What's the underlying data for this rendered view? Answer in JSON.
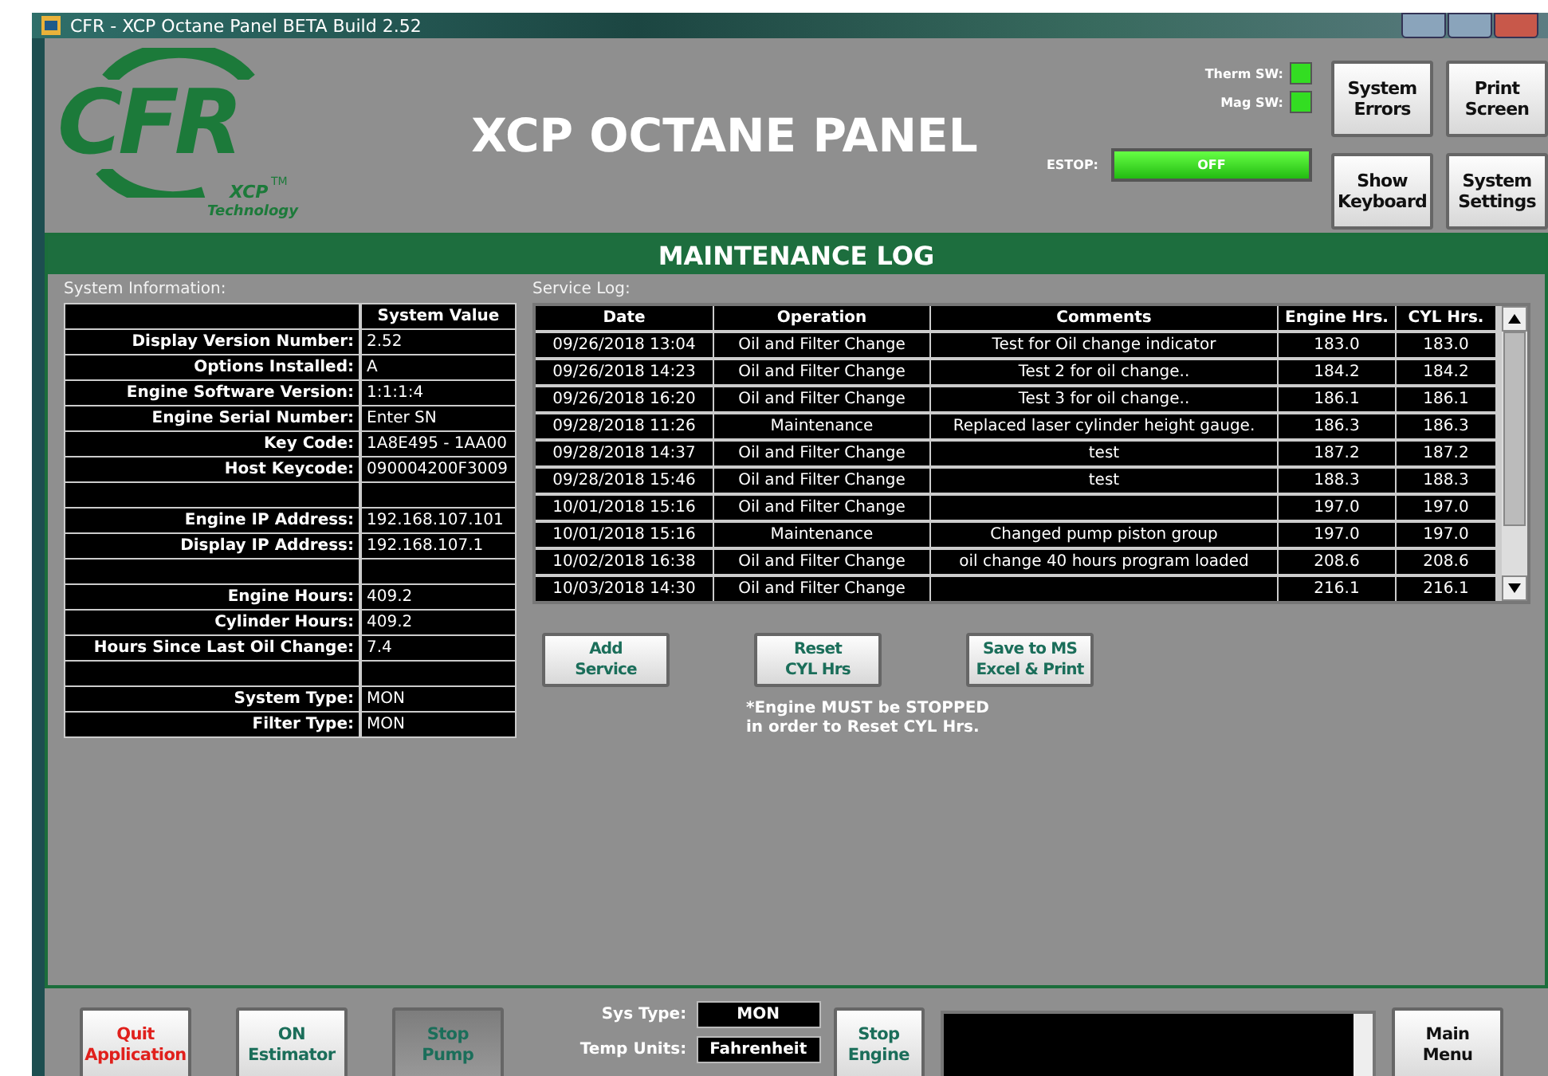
{
  "window": {
    "title": "CFR - XCP Octane Panel BETA Build 2.52"
  },
  "header": {
    "logo": {
      "text": "CFR",
      "sub": "XCP",
      "tm": "TM",
      "tagline": "Technology"
    },
    "title": "XCP OCTANE PANEL",
    "indicators": [
      {
        "label": "Therm SW:",
        "on": true
      },
      {
        "label": "Mag SW:",
        "on": true
      }
    ],
    "estop": {
      "label": "ESTOP:",
      "value": "OFF",
      "on": true
    },
    "buttons": [
      "System\nErrors",
      "Print\nScreen",
      "Show\nKeyboard",
      "System\nSettings"
    ]
  },
  "panel": {
    "title": "MAINTENANCE LOG"
  },
  "system_info": {
    "title": "System Information:",
    "value_header": "System Value",
    "rows": [
      {
        "label": "Display Version Number:",
        "value": "2.52"
      },
      {
        "label": "Options Installed:",
        "value": "A"
      },
      {
        "label": "Engine Software Version:",
        "value": "1:1:1:4"
      },
      {
        "label": "Engine Serial Number:",
        "value": "Enter SN"
      },
      {
        "label": "Key Code:",
        "value": "1A8E495 - 1AA00"
      },
      {
        "label": "Host Keycode:",
        "value": "090004200F3009"
      },
      {},
      {
        "label": "Engine IP Address:",
        "value": "192.168.107.101"
      },
      {
        "label": "Display IP Address:",
        "value": "192.168.107.1"
      },
      {},
      {
        "label": "Engine Hours:",
        "value": "409.2"
      },
      {
        "label": "Cylinder Hours:",
        "value": "409.2"
      },
      {
        "label": "Hours Since Last Oil Change:",
        "value": "7.4"
      },
      {},
      {
        "label": "System Type:",
        "value": "MON"
      },
      {
        "label": "Filter Type:",
        "value": "MON"
      }
    ]
  },
  "service_log": {
    "title": "Service Log:",
    "columns": [
      "Date",
      "Operation",
      "Comments",
      "Engine Hrs.",
      "CYL Hrs."
    ],
    "rows": [
      [
        "09/26/2018 13:04",
        "Oil and Filter Change",
        "Test for Oil change indicator",
        "183.0",
        "183.0"
      ],
      [
        "09/26/2018 14:23",
        "Oil and Filter Change",
        "Test 2 for oil change..",
        "184.2",
        "184.2"
      ],
      [
        "09/26/2018 16:20",
        "Oil and Filter Change",
        "Test 3 for oil change..",
        "186.1",
        "186.1"
      ],
      [
        "09/28/2018 11:26",
        "Maintenance",
        "Replaced laser cylinder height gauge.",
        "186.3",
        "186.3"
      ],
      [
        "09/28/2018 14:37",
        "Oil and Filter Change",
        "test",
        "187.2",
        "187.2"
      ],
      [
        "09/28/2018 15:46",
        "Oil and Filter Change",
        "test",
        "188.3",
        "188.3"
      ],
      [
        "10/01/2018 15:16",
        "Oil and Filter Change",
        null,
        "197.0",
        "197.0"
      ],
      [
        "10/01/2018 15:16",
        "Maintenance",
        "Changed pump piston group",
        "197.0",
        "197.0"
      ],
      [
        "10/02/2018 16:38",
        "Oil and Filter Change",
        "oil change 40 hours program loaded",
        "208.6",
        "208.6"
      ],
      [
        "10/03/2018 14:30",
        "Oil and Filter Change",
        null,
        "216.1",
        "216.1"
      ]
    ]
  },
  "actions": [
    "Add\nService",
    "Reset\nCYL Hrs",
    "Save to MS\nExcel & Print"
  ],
  "note": [
    "*Engine MUST be STOPPED",
    "in order to Reset CYL Hrs."
  ],
  "footer": {
    "buttons": [
      {
        "label": "Quit\nApplication",
        "kind": "danger",
        "pressed": false
      },
      {
        "label": "ON\nEstimator",
        "kind": "normal",
        "pressed": false
      },
      {
        "label": "Stop\nPump",
        "kind": "normal",
        "pressed": true
      }
    ],
    "fields": [
      {
        "label": "Sys Type:",
        "value": "MON"
      },
      {
        "label": "Temp Units:",
        "value": "Fahrenheit"
      }
    ],
    "engine_button": "Stop\nEngine",
    "menu_button": "Main\nMenu"
  }
}
